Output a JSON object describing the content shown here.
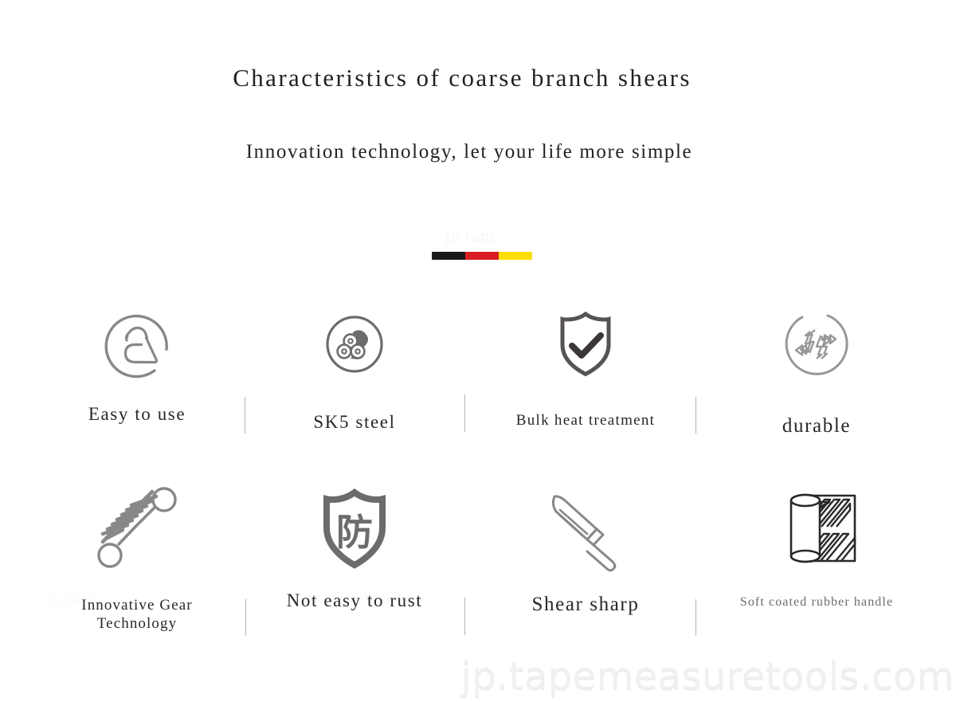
{
  "header": {
    "title": "Characteristics of coarse branch shears",
    "subtitle": "Innovation technology, let your life more simple"
  },
  "divider": {
    "name": "tricolor-divider",
    "colors": [
      "#1a1a1a",
      "#d81e23",
      "#fcdd09"
    ],
    "segments": 3
  },
  "features": [
    {
      "icon": "easy-grip-hand-circle-icon",
      "label": "Easy to use"
    },
    {
      "icon": "steel-coils-circle-icon",
      "label": "SK5 steel"
    },
    {
      "icon": "shield-check-icon",
      "label": "Bulk heat treatment"
    },
    {
      "icon": "recycle-arrows-circle-icon",
      "label": "durable"
    },
    {
      "icon": "coil-spring-icon",
      "label": "Innovative Gear\nTechnology"
    },
    {
      "icon": "shield-rust-prevention-icon",
      "label": "Not easy to rust"
    },
    {
      "icon": "knife-blade-icon",
      "label": "Shear sharp"
    },
    {
      "icon": "rubber-grip-texture-icon",
      "label": "Soft coated rubber handle"
    }
  ],
  "icon_glyphs": {
    "shield_rust_character": "防"
  },
  "watermark": {
    "domain": "jp.tapemeasuretools.com",
    "faint_center": "jp.tape",
    "ghosts": [
      "jp.tape",
      "measure",
      "tools"
    ]
  },
  "colors": {
    "text": "#241f20",
    "icon_stroke": "#8a8789",
    "icon_stroke_dark": "#595657",
    "separator": "#b4b1b2",
    "watermark": "#f0f0f1",
    "background": "#ffffff"
  }
}
